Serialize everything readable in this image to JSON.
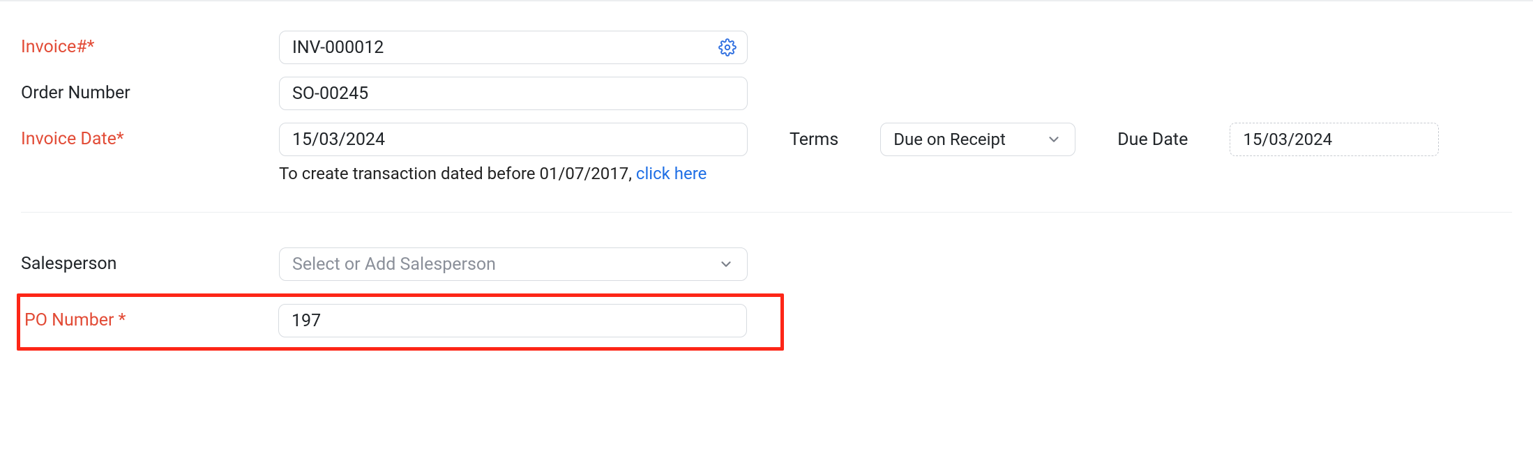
{
  "fields": {
    "invoice_number": {
      "label": "Invoice#*",
      "value": "INV-000012"
    },
    "order_number": {
      "label": "Order Number",
      "value": "SO-00245"
    },
    "invoice_date": {
      "label": "Invoice Date*",
      "value": "15/03/2024",
      "help_pre": "To create transaction dated before 01/07/2017, ",
      "help_link": "click here"
    },
    "terms": {
      "label": "Terms",
      "value": "Due on Receipt"
    },
    "due_date": {
      "label": "Due Date",
      "value": "15/03/2024"
    },
    "salesperson": {
      "label": "Salesperson",
      "placeholder": "Select or Add Salesperson"
    },
    "po_number": {
      "label": "PO Number *",
      "value": "197"
    }
  }
}
